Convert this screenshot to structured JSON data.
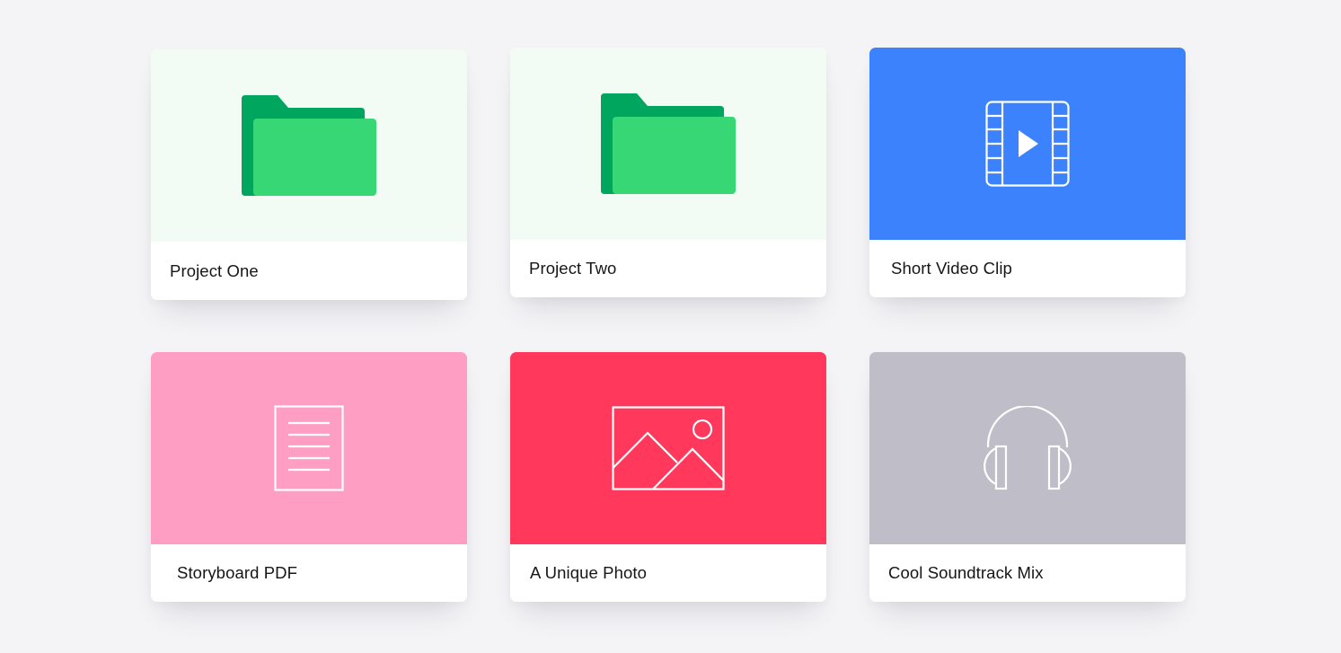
{
  "cards": [
    {
      "title": "Project One",
      "type": "folder",
      "icon": "folder-icon",
      "bg": "#f2fbf4"
    },
    {
      "title": "Project Two",
      "type": "folder",
      "icon": "folder-icon",
      "bg": "#f2fbf4"
    },
    {
      "title": "Short Video Clip",
      "type": "video",
      "icon": "video-film-icon",
      "bg": "#3b82fc"
    },
    {
      "title": "Storyboard PDF",
      "type": "document",
      "icon": "document-icon",
      "bg": "#ff9ec3"
    },
    {
      "title": "A Unique Photo",
      "type": "image",
      "icon": "image-icon",
      "bg": "#ff385c"
    },
    {
      "title": "Cool Soundtrack Mix",
      "type": "audio",
      "icon": "headphones-icon",
      "bg": "#bfbdc8"
    }
  ],
  "colors": {
    "page_bg": "#f4f4f6",
    "folder_back": "#00a65e",
    "folder_front": "#38d776",
    "icon_line": "#ffffff",
    "label_text": "#161616"
  }
}
